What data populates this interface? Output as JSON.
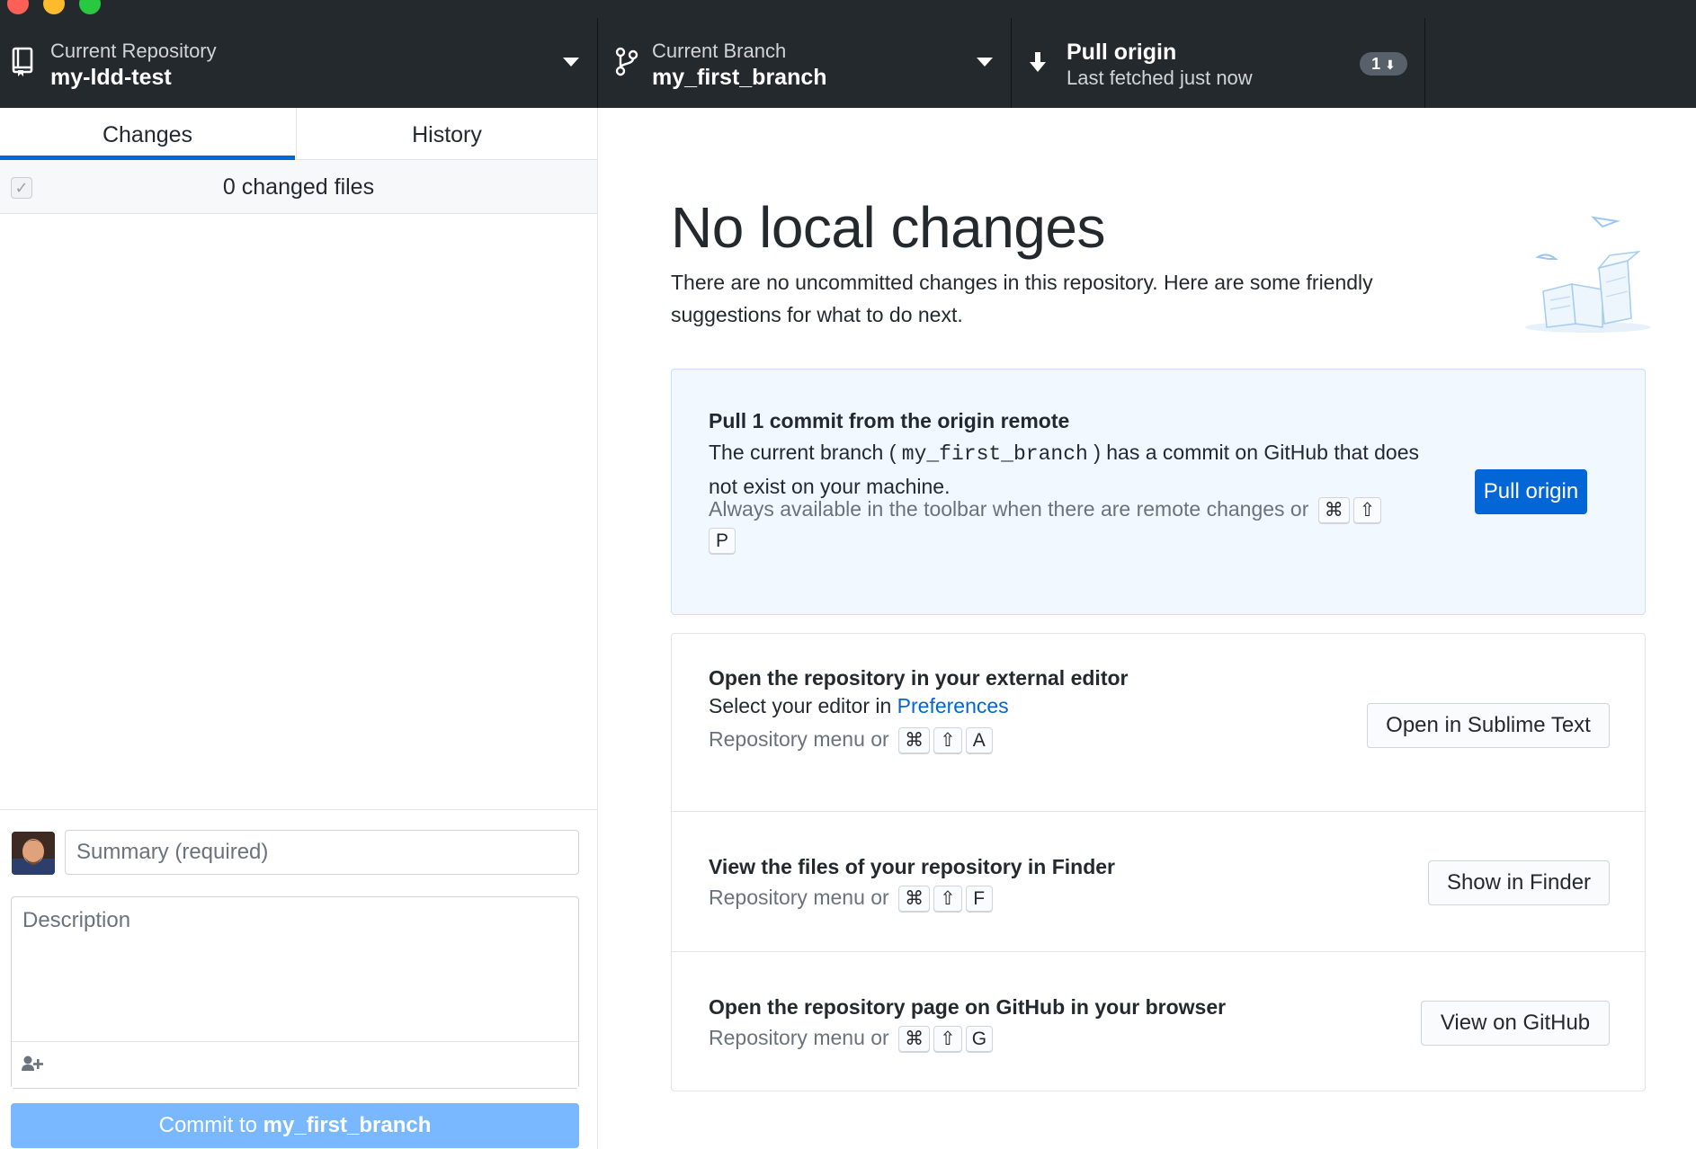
{
  "colors": {
    "toolbar_bg": "#24292e",
    "accent": "#0366d6",
    "commit_button": "#79b8ff",
    "pull_card_bg": "#f1f8ff"
  },
  "toolbar": {
    "repository": {
      "label": "Current Repository",
      "value": "my-ldd-test",
      "icon": "repo-icon"
    },
    "branch": {
      "label": "Current Branch",
      "value": "my_first_branch",
      "icon": "git-branch-icon"
    },
    "pull": {
      "label": "Pull origin",
      "sublabel": "Last fetched just now",
      "icon": "arrow-down-icon",
      "badge_count": "1"
    }
  },
  "sidebar": {
    "tabs": [
      {
        "label": "Changes",
        "active": true
      },
      {
        "label": "History",
        "active": false
      }
    ],
    "changed_files": "0 changed files",
    "commit": {
      "summary_placeholder": "Summary (required)",
      "description_placeholder": "Description",
      "button_prefix": "Commit to ",
      "button_branch": "my_first_branch"
    }
  },
  "main": {
    "heading": "No local changes",
    "intro": "There are no uncommitted changes in this repository. Here are some friendly suggestions for what to do next.",
    "pull_card": {
      "title": "Pull 1 commit from the origin remote",
      "text_prefix": "The current branch ( ",
      "branch": "my_first_branch",
      "text_suffix": " ) has a commit on GitHub that does not exist on your machine.",
      "hint": "Always available in the toolbar when there are remote changes or",
      "shortcut": [
        "⌘",
        "⇧",
        "P"
      ],
      "button": "Pull origin"
    },
    "editor_card": {
      "title": "Open the repository in your external editor",
      "text_prefix": "Select your editor in ",
      "link": "Preferences",
      "hint": "Repository menu or",
      "shortcut": [
        "⌘",
        "⇧",
        "A"
      ],
      "button": "Open in Sublime Text"
    },
    "finder_card": {
      "title": "View the files of your repository in Finder",
      "hint": "Repository menu or",
      "shortcut": [
        "⌘",
        "⇧",
        "F"
      ],
      "button": "Show in Finder"
    },
    "github_card": {
      "title": "Open the repository page on GitHub in your browser",
      "hint": "Repository menu or",
      "shortcut": [
        "⌘",
        "⇧",
        "G"
      ],
      "button": "View on GitHub"
    }
  }
}
